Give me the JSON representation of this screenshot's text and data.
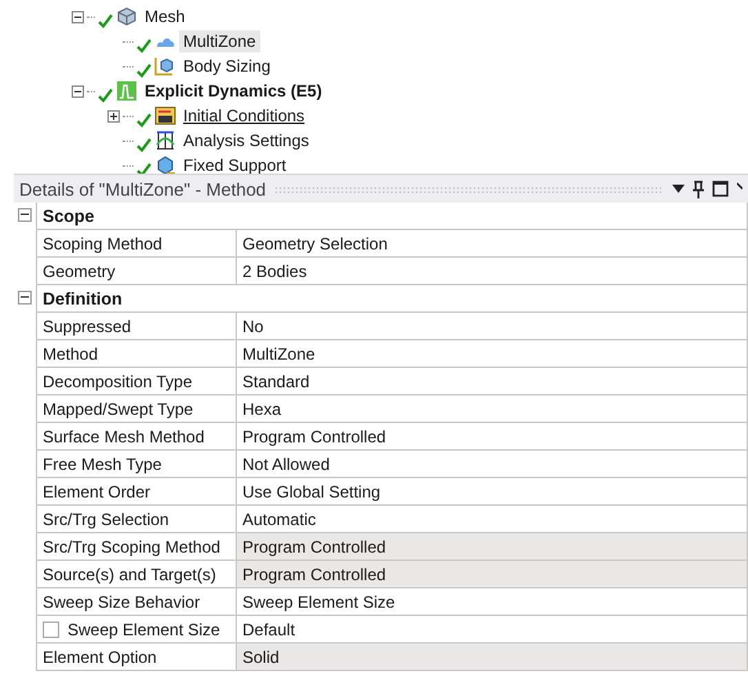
{
  "tree": [
    {
      "label": "Mesh",
      "kind": "mesh",
      "expanded": true,
      "selected": false,
      "hovered": false,
      "children": [
        {
          "label": "MultiZone",
          "kind": "method",
          "selected": true,
          "hovered": false
        },
        {
          "label": "Body Sizing",
          "kind": "sizing",
          "selected": false,
          "hovered": false
        }
      ]
    },
    {
      "label": "Explicit Dynamics (E5)",
      "kind": "analysis",
      "expanded": true,
      "selected": false,
      "hovered": false,
      "children": [
        {
          "label": "Initial Conditions",
          "kind": "initial",
          "expanded": false,
          "selected": false,
          "hovered": true
        },
        {
          "label": "Analysis Settings",
          "kind": "settings",
          "selected": false,
          "hovered": false
        },
        {
          "label": "Fixed Support",
          "kind": "support",
          "selected": false,
          "hovered": false
        }
      ]
    }
  ],
  "details": {
    "title": "Details of \"MultiZone\" - Method",
    "sections": [
      {
        "label": "Scope",
        "expanded": true,
        "rows": [
          {
            "kind": "plain",
            "name": "Scoping Method",
            "value": "Geometry Selection",
            "readonly": false
          },
          {
            "kind": "plain",
            "name": "Geometry",
            "value": "2 Bodies",
            "readonly": false
          }
        ]
      },
      {
        "label": "Definition",
        "expanded": true,
        "rows": [
          {
            "kind": "plain",
            "name": "Suppressed",
            "value": "No",
            "readonly": false
          },
          {
            "kind": "plain",
            "name": "Method",
            "value": "MultiZone",
            "readonly": false
          },
          {
            "kind": "plain",
            "name": "Decomposition Type",
            "value": "Standard",
            "readonly": false
          },
          {
            "kind": "plain",
            "name": "Mapped/Swept Type",
            "value": "Hexa",
            "readonly": false
          },
          {
            "kind": "plain",
            "name": "Surface Mesh Method",
            "value": "Program Controlled",
            "readonly": false
          },
          {
            "kind": "plain",
            "name": "Free Mesh Type",
            "value": "Not Allowed",
            "readonly": false
          },
          {
            "kind": "plain",
            "name": "Element Order",
            "value": "Use Global Setting",
            "readonly": false
          },
          {
            "kind": "plain",
            "name": "Src/Trg Selection",
            "value": "Automatic",
            "readonly": false
          },
          {
            "kind": "plain",
            "name": "Src/Trg Scoping Method",
            "value": "Program Controlled",
            "readonly": true
          },
          {
            "kind": "plain",
            "name": "Source(s) and Target(s)",
            "value": "Program Controlled",
            "readonly": true
          },
          {
            "kind": "plain",
            "name": "Sweep Size Behavior",
            "value": "Sweep Element Size",
            "readonly": false
          },
          {
            "kind": "checkbox",
            "checked": false,
            "name": "Sweep Element Size",
            "value": "Default",
            "readonly": false
          },
          {
            "kind": "plain",
            "name": "Element Option",
            "value": "Solid",
            "readonly": true
          }
        ]
      }
    ]
  }
}
